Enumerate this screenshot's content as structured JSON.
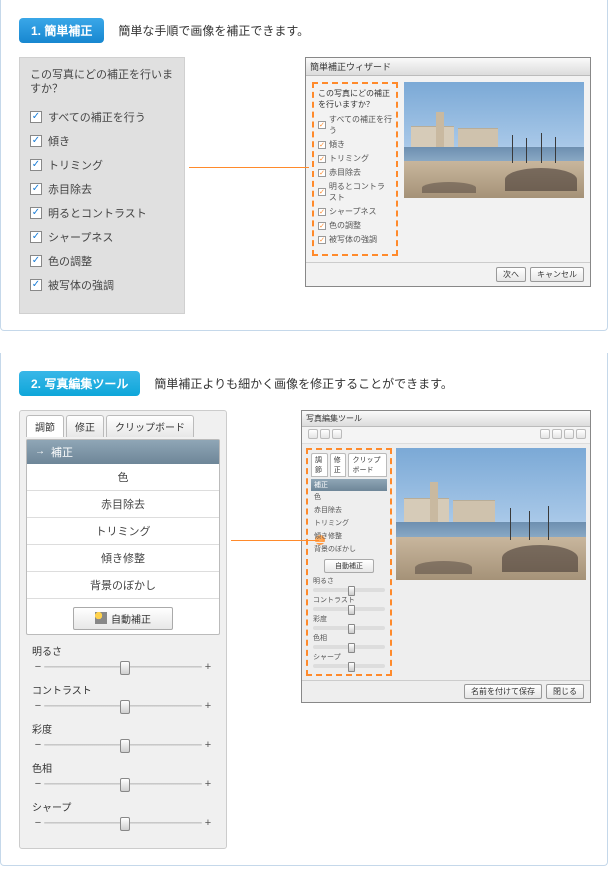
{
  "section1": {
    "badge": "1. 簡単補正",
    "desc": "簡単な手順で画像を補正できます。",
    "panel_question": "この写真にどの補正を行いますか？",
    "items": [
      "すべての補正を行う",
      "傾き",
      "トリミング",
      "赤目除去",
      "明るとコントラスト",
      "シャープネス",
      "色の調整",
      "被写体の強調"
    ],
    "dialog": {
      "title": "簡単補正ウィザード",
      "question": "この写真にどの補正を行いますか？",
      "items": [
        "すべての補正を行う",
        "傾き",
        "トリミング",
        "赤目除去",
        "明るとコントラスト",
        "シャープネス",
        "色の調整",
        "被写体の強調"
      ],
      "next": "次へ",
      "cancel": "キャンセル"
    }
  },
  "section2": {
    "badge": "2. 写真編集ツール",
    "desc": "簡単補正よりも細かく画像を修正することができます。",
    "tabs": {
      "adjust": "調節",
      "fix": "修正",
      "clip": "クリップボード"
    },
    "menu_header": "補正",
    "menu": [
      "色",
      "赤目除去",
      "トリミング",
      "傾き修整",
      "背景のぼかし"
    ],
    "auto_btn": "自動補正",
    "sliders": {
      "brightness": "明るさ",
      "contrast": "コントラスト",
      "saturation": "彩度",
      "hue": "色相",
      "sharp": "シャープ"
    },
    "dialog": {
      "title": "写真編集ツール",
      "tabs": [
        "調節",
        "修正",
        "クリップボード"
      ],
      "menu_header": "補正",
      "menu": [
        "色",
        "赤目除去",
        "トリミング",
        "傾き修整",
        "背景のぼかし"
      ],
      "auto_btn": "自動補正",
      "slabels": [
        "明るさ",
        "コントラスト",
        "彩度",
        "色相",
        "シャープ"
      ],
      "save": "名前を付けて保存",
      "close": "閉じる"
    }
  }
}
